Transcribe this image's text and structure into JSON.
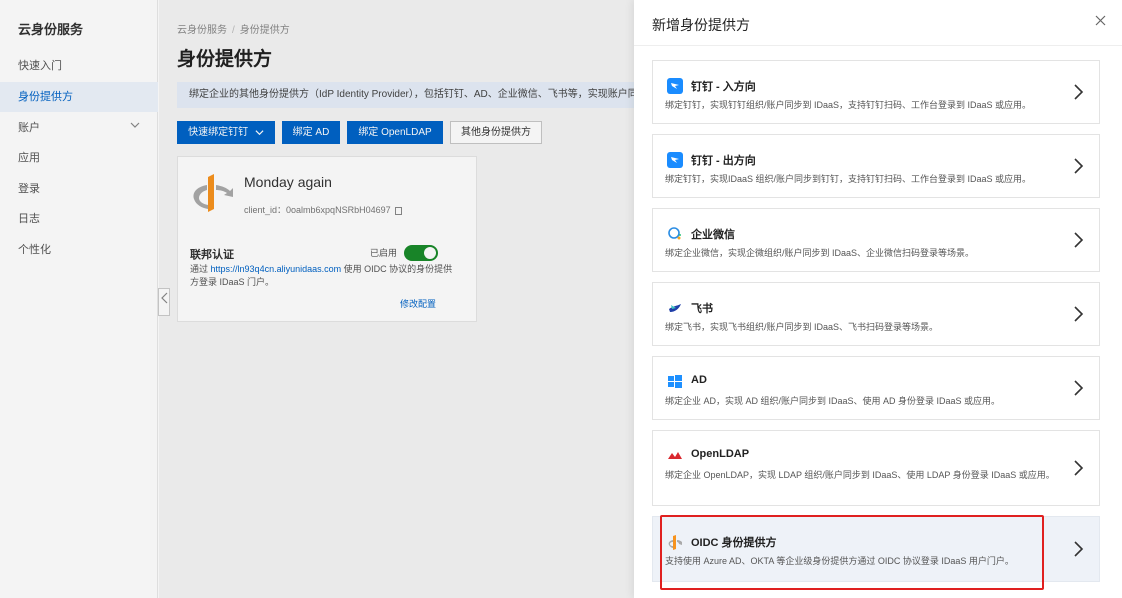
{
  "sidebar": {
    "title": "云身份服务",
    "items": [
      {
        "label": "快速入门"
      },
      {
        "label": "身份提供方"
      },
      {
        "label": "账户",
        "chevron": "chevron-down-icon"
      },
      {
        "label": "应用"
      },
      {
        "label": "登录"
      },
      {
        "label": "日志"
      },
      {
        "label": "个性化"
      }
    ]
  },
  "main": {
    "breadcrumb": [
      "云身份服务",
      "身份提供方"
    ],
    "title": "身份提供方",
    "notice": "绑定企业的其他身份提供方（IdP Identity Provider），包括钉钉、AD、企业微信、飞书等，实现账户同步、",
    "buttons": {
      "quick_bind": "快速绑定钉钉",
      "bind_ad": "绑定 AD",
      "bind_ldap": "绑定 OpenLDAP",
      "other": "其他身份提供方"
    },
    "card": {
      "name": "Monday again",
      "client_id_label": "client_id：",
      "client_id": "0oalmb6xpqNSRbH04697",
      "federation_title": "联邦认证",
      "status": "已启用",
      "enabled": true,
      "desc_prefix": "通过",
      "desc_link": "https://ln93q4cn.aliyunidaas.com",
      "desc_suffix": "使用 OIDC 协议的身份提供方登录 IDaaS 门户。",
      "modify_label": "修改配置"
    }
  },
  "drawer": {
    "title": "新增身份提供方",
    "close_icon": "close-icon",
    "options": [
      {
        "name": "钉钉 - 入方向",
        "icon": "dingtalk-icon",
        "desc": "绑定钉钉，实现钉钉组织/账户同步到 IDaaS，支持钉钉扫码、工作台登录到 IDaaS 或应用。"
      },
      {
        "name": "钉钉 - 出方向",
        "icon": "dingtalk-icon",
        "desc": "绑定钉钉，实现IDaaS 组织/账户同步到钉钉，支持钉钉扫码、工作台登录到 IDaaS 或应用。"
      },
      {
        "name": "企业微信",
        "icon": "wecom-icon",
        "desc": "绑定企业微信，实现企微组织/账户同步到 IDaaS、企业微信扫码登录等场景。"
      },
      {
        "name": "飞书",
        "icon": "feishu-icon",
        "desc": "绑定飞书，实现飞书组织/账户同步到 IDaaS、飞书扫码登录等场景。"
      },
      {
        "name": "AD",
        "icon": "windows-icon",
        "desc": "绑定企业 AD，实现 AD 组织/账户同步到 IDaaS、使用 AD 身份登录 IDaaS 或应用。"
      },
      {
        "name": "OpenLDAP",
        "icon": "openldap-icon",
        "desc": "绑定企业 OpenLDAP，实现 LDAP 组织/账户同步到 IDaaS、使用 LDAP 身份登录 IDaaS 或应用。"
      },
      {
        "name": "OIDC 身份提供方",
        "icon": "openid-icon",
        "desc": "支持使用 Azure AD、OKTA 等企业级身份提供方通过 OIDC 协议登录 IDaaS 用户门户。",
        "highlighted": true
      }
    ]
  },
  "colors": {
    "primary": "#0064c8",
    "toggle_on": "#1a8a2a",
    "highlight_border": "#e02020",
    "accent_strip": "#ff6a00"
  }
}
